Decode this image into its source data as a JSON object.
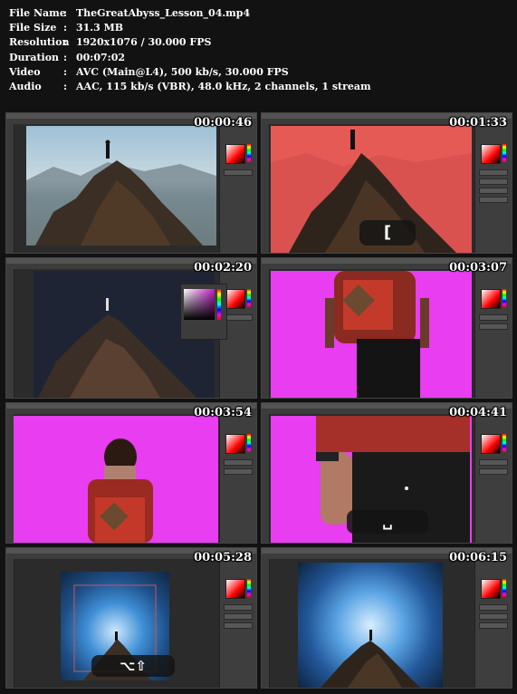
{
  "meta": {
    "file_name": {
      "key": "File Name",
      "sep": ":",
      "value": "TheGreatAbyss_Lesson_04.mp4"
    },
    "file_size": {
      "key": "File Size",
      "sep": ":",
      "value": "31.3 MB"
    },
    "resolution": {
      "key": "Resolution",
      "sep": ":",
      "value": "1920x1076 / 30.000 FPS"
    },
    "duration": {
      "key": "Duration",
      "sep": ":",
      "value": "00:07:02"
    },
    "video": {
      "key": "Video",
      "sep": ":",
      "value": "AVC (Main@L4), 500 kb/s, 30.000 FPS"
    },
    "audio": {
      "key": "Audio",
      "sep": ":",
      "value": "AAC, 115 kb/s (VBR), 48.0 kHz, 2 channels, 1 stream"
    }
  },
  "thumbnails": [
    {
      "timestamp": "00:00:46"
    },
    {
      "timestamp": "00:01:33",
      "hud": "["
    },
    {
      "timestamp": "00:02:20"
    },
    {
      "timestamp": "00:03:07"
    },
    {
      "timestamp": "00:03:54"
    },
    {
      "timestamp": "00:04:41",
      "hud": "␣"
    },
    {
      "timestamp": "00:05:28",
      "hud": "⌥⇧"
    },
    {
      "timestamp": "00:06:15"
    }
  ],
  "colors": {
    "magenta": "#e83df0",
    "red_overlay": "#e65a55",
    "dark_bg": "#1e2433",
    "sky_blue": "#3f8fd6"
  }
}
